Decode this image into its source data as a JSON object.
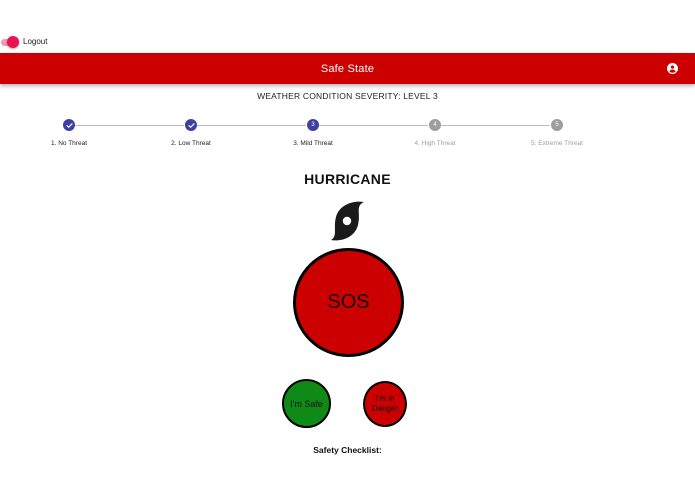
{
  "logout": {
    "label": "Logout",
    "enabled": true
  },
  "header": {
    "title": "Safe State",
    "background_color": "#cc0000",
    "account_icon": "account-circle-icon"
  },
  "severity": {
    "text": "WEATHER CONDITION SEVERITY: LEVEL 3"
  },
  "stepper": {
    "current_step": 3,
    "steps": [
      {
        "number": "1",
        "label": "1. No Threat",
        "state": "completed"
      },
      {
        "number": "2",
        "label": "2. Low Threat",
        "state": "completed"
      },
      {
        "number": "3",
        "label": "3. Mild Threat",
        "state": "active"
      },
      {
        "number": "4",
        "label": "4. High Threat",
        "state": "pending"
      },
      {
        "number": "5",
        "label": "5. Extreme Threat",
        "state": "pending"
      }
    ]
  },
  "threat": {
    "title": "HURRICANE",
    "icon": "hurricane-icon"
  },
  "actions": {
    "sos_label": "SOS",
    "safe_label": "I'm Safe",
    "danger_label": "I'm in Danger",
    "sos_color": "#cc0000",
    "safe_color": "#0f8a16",
    "danger_color": "#cc0000"
  },
  "checklist": {
    "title": "Safety Checklist:"
  }
}
